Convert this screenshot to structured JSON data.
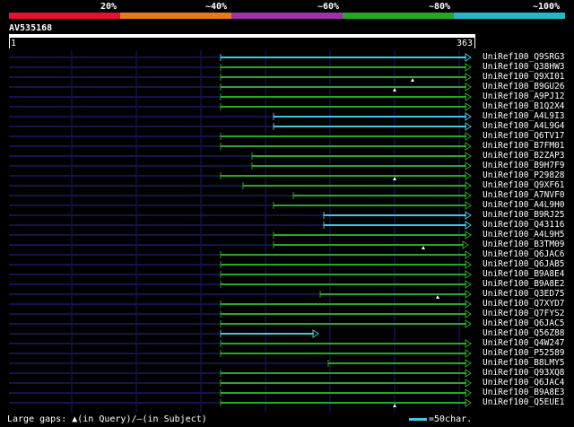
{
  "header": {
    "percent_labels": [
      "20%",
      "~40%",
      "~60%",
      "~80%",
      "~100%"
    ],
    "color_segments": [
      "#e8102e",
      "#e87818",
      "#a030a8",
      "#22a822",
      "#22b8c8"
    ]
  },
  "query": {
    "title": "AV535168",
    "start": "1",
    "end": "363"
  },
  "colors": {
    "cyan": "#40c8e0",
    "green": "#28a828",
    "grid": "#1a1a6a",
    "marker": "#ffffff"
  },
  "hits": [
    {
      "name": "UniRef100_Q9SRG3",
      "start": 246,
      "end": 525,
      "color": "cyan"
    },
    {
      "name": "UniRef100_Q38HW3",
      "start": 246,
      "end": 525,
      "color": "green"
    },
    {
      "name": "UniRef100_Q9XI01",
      "start": 246,
      "end": 525,
      "color": "green"
    },
    {
      "name": "UniRef100_B9GU26",
      "start": 246,
      "end": 525,
      "color": "green"
    },
    {
      "name": "UniRef100_A9PJ12",
      "start": 246,
      "end": 525,
      "color": "green"
    },
    {
      "name": "UniRef100_B1Q2X4",
      "start": 246,
      "end": 525,
      "color": "green"
    },
    {
      "name": "UniRef100_A4L9I3",
      "start": 305,
      "end": 525,
      "color": "cyan"
    },
    {
      "name": "UniRef100_A4L9G4",
      "start": 305,
      "end": 525,
      "color": "cyan"
    },
    {
      "name": "UniRef100_Q6TV17",
      "start": 246,
      "end": 525,
      "color": "green"
    },
    {
      "name": "UniRef100_B7FM01",
      "start": 246,
      "end": 525,
      "color": "green"
    },
    {
      "name": "UniRef100_B2ZAP3",
      "start": 281,
      "end": 525,
      "color": "green"
    },
    {
      "name": "UniRef100_B9H7F9",
      "start": 281,
      "end": 525,
      "color": "green"
    },
    {
      "name": "UniRef100_P29828",
      "start": 246,
      "end": 525,
      "color": "green"
    },
    {
      "name": "UniRef100_Q9XF61",
      "start": 271,
      "end": 525,
      "color": "green"
    },
    {
      "name": "UniRef100_A7NVF0",
      "start": 327,
      "end": 525,
      "color": "green"
    },
    {
      "name": "UniRef100_A4L9H0",
      "start": 305,
      "end": 525,
      "color": "green"
    },
    {
      "name": "UniRef100_B9RJ25",
      "start": 361,
      "end": 525,
      "color": "cyan"
    },
    {
      "name": "UniRef100_Q43116",
      "start": 361,
      "end": 525,
      "color": "cyan"
    },
    {
      "name": "UniRef100_A4L9H5",
      "start": 305,
      "end": 525,
      "color": "green"
    },
    {
      "name": "UniRef100_B3TM09",
      "start": 305,
      "end": 522,
      "color": "green"
    },
    {
      "name": "UniRef100_Q6JAC6",
      "start": 246,
      "end": 525,
      "color": "green"
    },
    {
      "name": "UniRef100_Q6JAB5",
      "start": 246,
      "end": 525,
      "color": "green"
    },
    {
      "name": "UniRef100_B9A8E4",
      "start": 246,
      "end": 525,
      "color": "green"
    },
    {
      "name": "UniRef100_B9A8E2",
      "start": 246,
      "end": 525,
      "color": "green"
    },
    {
      "name": "UniRef100_Q3ED75",
      "start": 357,
      "end": 525,
      "color": "green"
    },
    {
      "name": "UniRef100_Q7XYD7",
      "start": 246,
      "end": 525,
      "color": "green"
    },
    {
      "name": "UniRef100_Q7FYS2",
      "start": 246,
      "end": 525,
      "color": "green"
    },
    {
      "name": "UniRef100_Q6JAC5",
      "start": 246,
      "end": 525,
      "color": "green"
    },
    {
      "name": "UniRef100_Q56Z88",
      "start": 246,
      "end": 355,
      "color": "cyan"
    },
    {
      "name": "UniRef100_Q4W247",
      "start": 246,
      "end": 525,
      "color": "green"
    },
    {
      "name": "UniRef100_P52589",
      "start": 246,
      "end": 525,
      "color": "green"
    },
    {
      "name": "UniRef100_B8LMY5",
      "start": 366,
      "end": 525,
      "color": "green"
    },
    {
      "name": "UniRef100_Q93XQ8",
      "start": 246,
      "end": 525,
      "color": "green"
    },
    {
      "name": "UniRef100_Q6JAC4",
      "start": 246,
      "end": 525,
      "color": "green"
    },
    {
      "name": "UniRef100_B9A8E3",
      "start": 246,
      "end": 525,
      "color": "green"
    },
    {
      "name": "UniRef100_Q5EUE1",
      "start": 246,
      "end": 525,
      "color": "green"
    }
  ],
  "footer": {
    "gaps_legend": "Large gaps: ▲(in Query)/—(in Subject)",
    "scale_legend": "=50char."
  }
}
